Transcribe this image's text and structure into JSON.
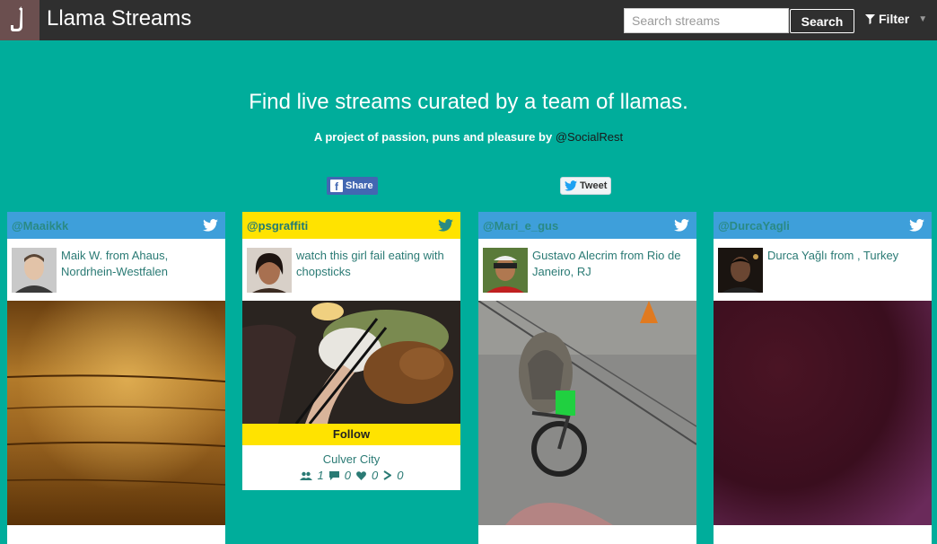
{
  "header": {
    "app_title": "Llama Streams",
    "search_placeholder": "Search streams",
    "search_button": "Search",
    "filter_label": "Filter"
  },
  "hero": {
    "title": "Find live streams curated by a team of llamas.",
    "subtitle_prefix": "A project of passion, puns and pleasure by",
    "subtitle_handle": "@SocialRest",
    "share_label": "Share",
    "tweet_label": "Tweet"
  },
  "colors": {
    "background": "#00ad9b",
    "header": "#2f2f2f",
    "card_head_blue": "#3e9fda",
    "card_head_yellow": "#ffe300"
  },
  "cards": [
    {
      "handle": "@Maaikkk",
      "text": "Maik W. from Ahaus, Nordrhein-Westfalen"
    },
    {
      "handle": "@psgraffiti",
      "text": "watch this girl fail eating with chopsticks",
      "follow_label": "Follow",
      "location": "Culver City",
      "stats": {
        "viewers": "1",
        "comments": "0",
        "hearts": "0",
        "shares": "0"
      }
    },
    {
      "handle": "@Mari_e_gus",
      "text": "Gustavo Alecrim from Rio de Janeiro, RJ"
    },
    {
      "handle": "@DurcaYagli",
      "text": "Durca Yağlı from , Turkey"
    }
  ]
}
